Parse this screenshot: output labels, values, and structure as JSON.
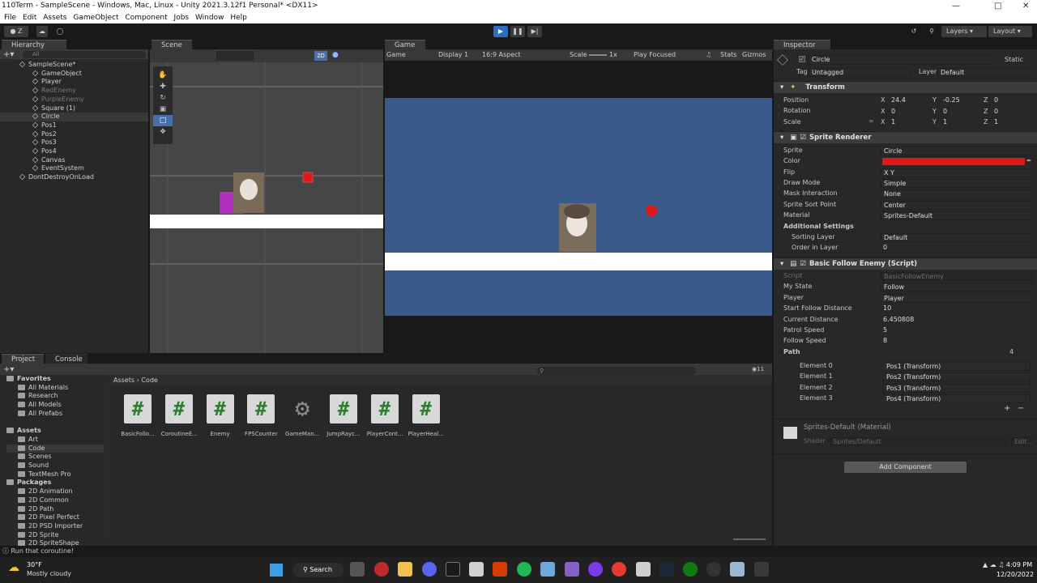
{
  "window": {
    "title": "110Term - SampleScene - Windows, Mac, Linux - Unity 2021.3.12f1 Personal* <DX11>"
  },
  "menu": [
    "File",
    "Edit",
    "Assets",
    "GameObject",
    "Component",
    "Jobs",
    "Window",
    "Help"
  ],
  "toolbar": {
    "account": "Z",
    "layers": "Layers",
    "layout": "Layout"
  },
  "hierarchy": {
    "tab": "Hierarchy",
    "search": "All",
    "items": [
      {
        "label": "SampleScene*",
        "dim": false,
        "sel": false,
        "indent": 0
      },
      {
        "label": "GameObject",
        "dim": false,
        "sel": false,
        "indent": 1
      },
      {
        "label": "Player",
        "dim": false,
        "sel": false,
        "indent": 1
      },
      {
        "label": "RedEnemy",
        "dim": true,
        "sel": false,
        "indent": 1
      },
      {
        "label": "PurpleEnemy",
        "dim": true,
        "sel": false,
        "indent": 1
      },
      {
        "label": "Square (1)",
        "dim": false,
        "sel": false,
        "indent": 1
      },
      {
        "label": "Circle",
        "dim": false,
        "sel": true,
        "indent": 1
      },
      {
        "label": "Pos1",
        "dim": false,
        "sel": false,
        "indent": 1
      },
      {
        "label": "Pos2",
        "dim": false,
        "sel": false,
        "indent": 1
      },
      {
        "label": "Pos3",
        "dim": false,
        "sel": false,
        "indent": 1
      },
      {
        "label": "Pos4",
        "dim": false,
        "sel": false,
        "indent": 1
      },
      {
        "label": "Canvas",
        "dim": false,
        "sel": false,
        "indent": 1
      },
      {
        "label": "EventSystem",
        "dim": false,
        "sel": false,
        "indent": 1
      },
      {
        "label": "DontDestroyOnLoad",
        "dim": false,
        "sel": false,
        "indent": 0
      }
    ]
  },
  "scene": {
    "tab": "Scene",
    "mode2d": "2D"
  },
  "game": {
    "tab": "Game",
    "display": "Game",
    "displaynum": "Display 1",
    "aspect": "16:9 Aspect",
    "scale_label": "Scale",
    "scale_value": "1x",
    "focus": "Play Focused",
    "stats": "Stats",
    "gizmos": "Gizmos"
  },
  "inspector": {
    "tab": "Inspector",
    "object_name": "Circle",
    "static": "Static",
    "tag_label": "Tag",
    "tag": "Untagged",
    "layer_label": "Layer",
    "layer": "Default",
    "transform": {
      "title": "Transform",
      "position": "Position",
      "rotation": "Rotation",
      "scale": "Scale",
      "pos": [
        "24.4",
        "-0.25",
        "0"
      ],
      "rot": [
        "0",
        "0",
        "0"
      ],
      "scl": [
        "1",
        "1",
        "1"
      ]
    },
    "sprite_renderer": {
      "title": "Sprite Renderer",
      "rows": [
        {
          "label": "Sprite",
          "value": "Circle"
        },
        {
          "label": "Color",
          "value": ""
        },
        {
          "label": "Flip",
          "value": "X   Y"
        },
        {
          "label": "Draw Mode",
          "value": "Simple"
        },
        {
          "label": "Mask Interaction",
          "value": "None"
        },
        {
          "label": "Sprite Sort Point",
          "value": "Center"
        },
        {
          "label": "Material",
          "value": "Sprites-Default"
        }
      ],
      "additional": "Additional Settings",
      "sorting_layer": "Sorting Layer",
      "sorting_value": "Default",
      "order": "Order in Layer",
      "order_value": "0",
      "color": "#e01818"
    },
    "script": {
      "title": "Basic Follow Enemy (Script)",
      "rows": [
        {
          "label": "Script",
          "value": "BasicFollowEnemy"
        },
        {
          "label": "My State",
          "value": "Follow"
        },
        {
          "label": "Player",
          "value": "Player"
        },
        {
          "label": "Start Follow Distance",
          "value": "10"
        },
        {
          "label": "Current Distance",
          "value": "6.450808"
        },
        {
          "label": "Patrol Speed",
          "value": "5"
        },
        {
          "label": "Follow Speed",
          "value": "8"
        }
      ],
      "path": "Path",
      "path_count": "4",
      "elements": [
        {
          "label": "Element 0",
          "value": "Pos1 (Transform)"
        },
        {
          "label": "Element 1",
          "value": "Pos2 (Transform)"
        },
        {
          "label": "Element 2",
          "value": "Pos3 (Transform)"
        },
        {
          "label": "Element 3",
          "value": "Pos4 (Transform)"
        }
      ]
    },
    "material": {
      "title": "Sprites-Default (Material)",
      "shader_label": "Shader",
      "shader": "Sprites/Default",
      "edit": "Edit..."
    },
    "add_component": "Add Component"
  },
  "project": {
    "tab_project": "Project",
    "tab_console": "Console",
    "breadcrumb": [
      "Assets",
      "Code"
    ],
    "count": "11",
    "tree": [
      {
        "label": "Favorites",
        "indent": 0,
        "bold": true
      },
      {
        "label": "All Materials",
        "indent": 1
      },
      {
        "label": "Research",
        "indent": 1
      },
      {
        "label": "All Models",
        "indent": 1
      },
      {
        "label": "All Prefabs",
        "indent": 1
      },
      {
        "label": "",
        "indent": 0
      },
      {
        "label": "Assets",
        "indent": 0,
        "bold": true
      },
      {
        "label": "Art",
        "indent": 1
      },
      {
        "label": "Code",
        "indent": 1,
        "sel": true
      },
      {
        "label": "Scenes",
        "indent": 1
      },
      {
        "label": "Sound",
        "indent": 1
      },
      {
        "label": "TextMesh Pro",
        "indent": 1
      },
      {
        "label": "Packages",
        "indent": 0,
        "bold": true
      },
      {
        "label": "2D Animation",
        "indent": 1
      },
      {
        "label": "2D Common",
        "indent": 1
      },
      {
        "label": "2D Path",
        "indent": 1
      },
      {
        "label": "2D Pixel Perfect",
        "indent": 1
      },
      {
        "label": "2D PSD Importer",
        "indent": 1
      },
      {
        "label": "2D Sprite",
        "indent": 1
      },
      {
        "label": "2D SpriteShape",
        "indent": 1
      }
    ],
    "assets": [
      "BasicFollo...",
      "CoroutineE...",
      "Enemy",
      "FPSCounter",
      "GameMan...",
      "JumpRayc...",
      "PlayerCont...",
      "PlayerHeal..."
    ]
  },
  "statusbar": {
    "message": "Run that coroutine!"
  },
  "taskbar": {
    "temp": "30°F",
    "weather": "Mostly cloudy",
    "search": "Search",
    "time": "4:09 PM",
    "date": "12/20/2022"
  }
}
